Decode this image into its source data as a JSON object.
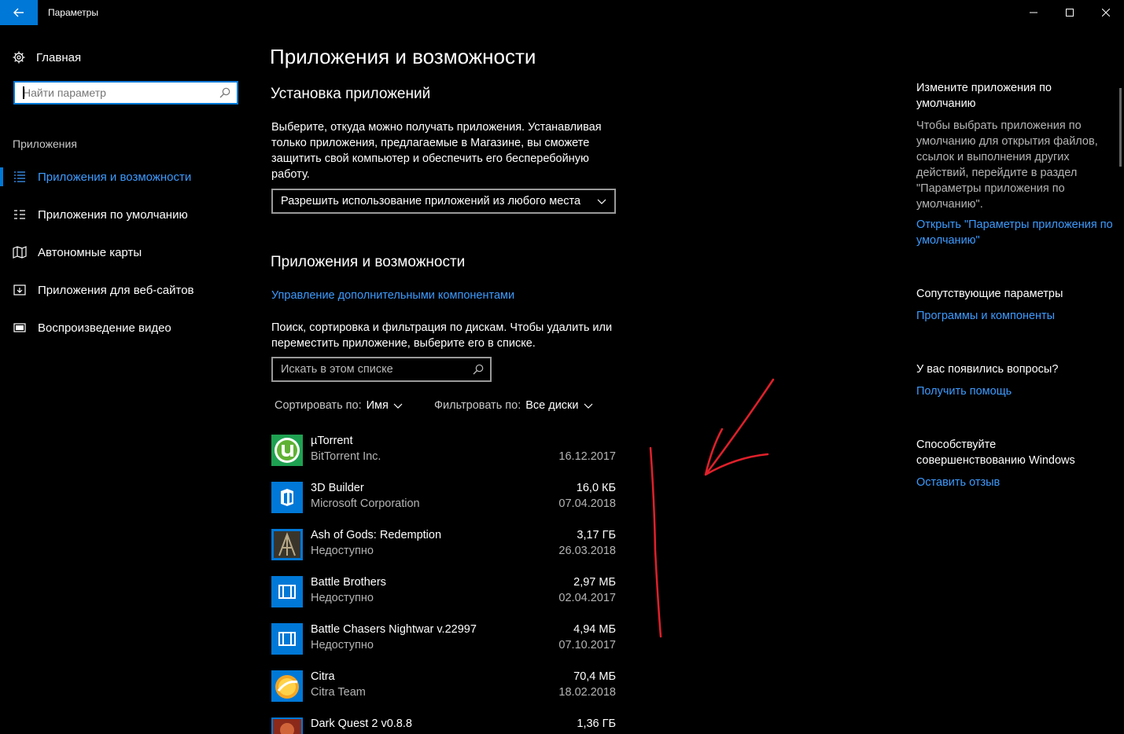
{
  "window": {
    "title": "Параметры"
  },
  "nav": {
    "home_label": "Главная",
    "search_placeholder": "Найти параметр",
    "section": "Приложения",
    "items": [
      {
        "label": "Приложения и возможности",
        "icon": "list-icon"
      },
      {
        "label": "Приложения по умолчанию",
        "icon": "default-apps-icon"
      },
      {
        "label": "Автономные карты",
        "icon": "map-icon"
      },
      {
        "label": "Приложения для веб-сайтов",
        "icon": "web-app-icon"
      },
      {
        "label": "Воспроизведение видео",
        "icon": "video-icon"
      }
    ]
  },
  "main": {
    "title": "Приложения и возможности",
    "install": {
      "heading": "Установка приложений",
      "description": "Выберите, откуда можно получать приложения. Устанавливая только приложения, предлагаемые в Магазине, вы сможете защитить свой компьютер и обеспечить его бесперебойную работу.",
      "selected_option": "Разрешить использование приложений из любого места"
    },
    "apps": {
      "heading": "Приложения и возможности",
      "manage_link": "Управление дополнительными компонентами",
      "description": "Поиск, сортировка и фильтрация по дискам. Чтобы удалить или переместить приложение, выберите его в списке.",
      "search_placeholder": "Искать в этом списке",
      "sort_label": "Сортировать по:",
      "sort_value": "Имя",
      "filter_label": "Фильтровать по:",
      "filter_value": "Все диски",
      "list": [
        {
          "name": "µTorrent",
          "publisher": "BitTorrent Inc.",
          "size": "",
          "date": "16.12.2017",
          "icon": "utorrent-icon"
        },
        {
          "name": "3D Builder",
          "publisher": "Microsoft Corporation",
          "size": "16,0 КБ",
          "date": "07.04.2018",
          "icon": "3d-builder-icon"
        },
        {
          "name": "Ash of Gods: Redemption",
          "publisher": "Недоступно",
          "size": "3,17 ГБ",
          "date": "26.03.2018",
          "icon": "ash-of-gods-icon"
        },
        {
          "name": "Battle Brothers",
          "publisher": "Недоступно",
          "size": "2,97 МБ",
          "date": "02.04.2017",
          "icon": "generic-app-icon"
        },
        {
          "name": "Battle Chasers Nightwar v.22997",
          "publisher": "Недоступно",
          "size": "4,94 МБ",
          "date": "07.10.2017",
          "icon": "generic-app-icon"
        },
        {
          "name": "Citra",
          "publisher": "Citra Team",
          "size": "70,4 МБ",
          "date": "18.02.2018",
          "icon": "citra-icon"
        },
        {
          "name": "Dark Quest 2 v0.8.8",
          "publisher": "",
          "size": "1,36 ГБ",
          "date": "",
          "icon": "dark-quest-icon"
        }
      ]
    }
  },
  "sidebar_right": {
    "defaults": {
      "heading": "Измените приложения по умолчанию",
      "text": "Чтобы выбрать приложения по умолчанию для открытия файлов, ссылок и выполнения других действий, перейдите в раздел \"Параметры приложения по умолчанию\".",
      "link": "Открыть \"Параметры приложения по умолчанию\""
    },
    "related": {
      "heading": "Сопутствующие параметры",
      "link": "Программы и компоненты"
    },
    "questions": {
      "heading": "У вас появились вопросы?",
      "link": "Получить помощь"
    },
    "feedback": {
      "heading": "Способствуйте совершенствованию Windows",
      "link": "Оставить отзыв"
    }
  },
  "colors": {
    "accent": "#0078d7",
    "link": "#3d9bff",
    "annotation": "#e0202a"
  }
}
